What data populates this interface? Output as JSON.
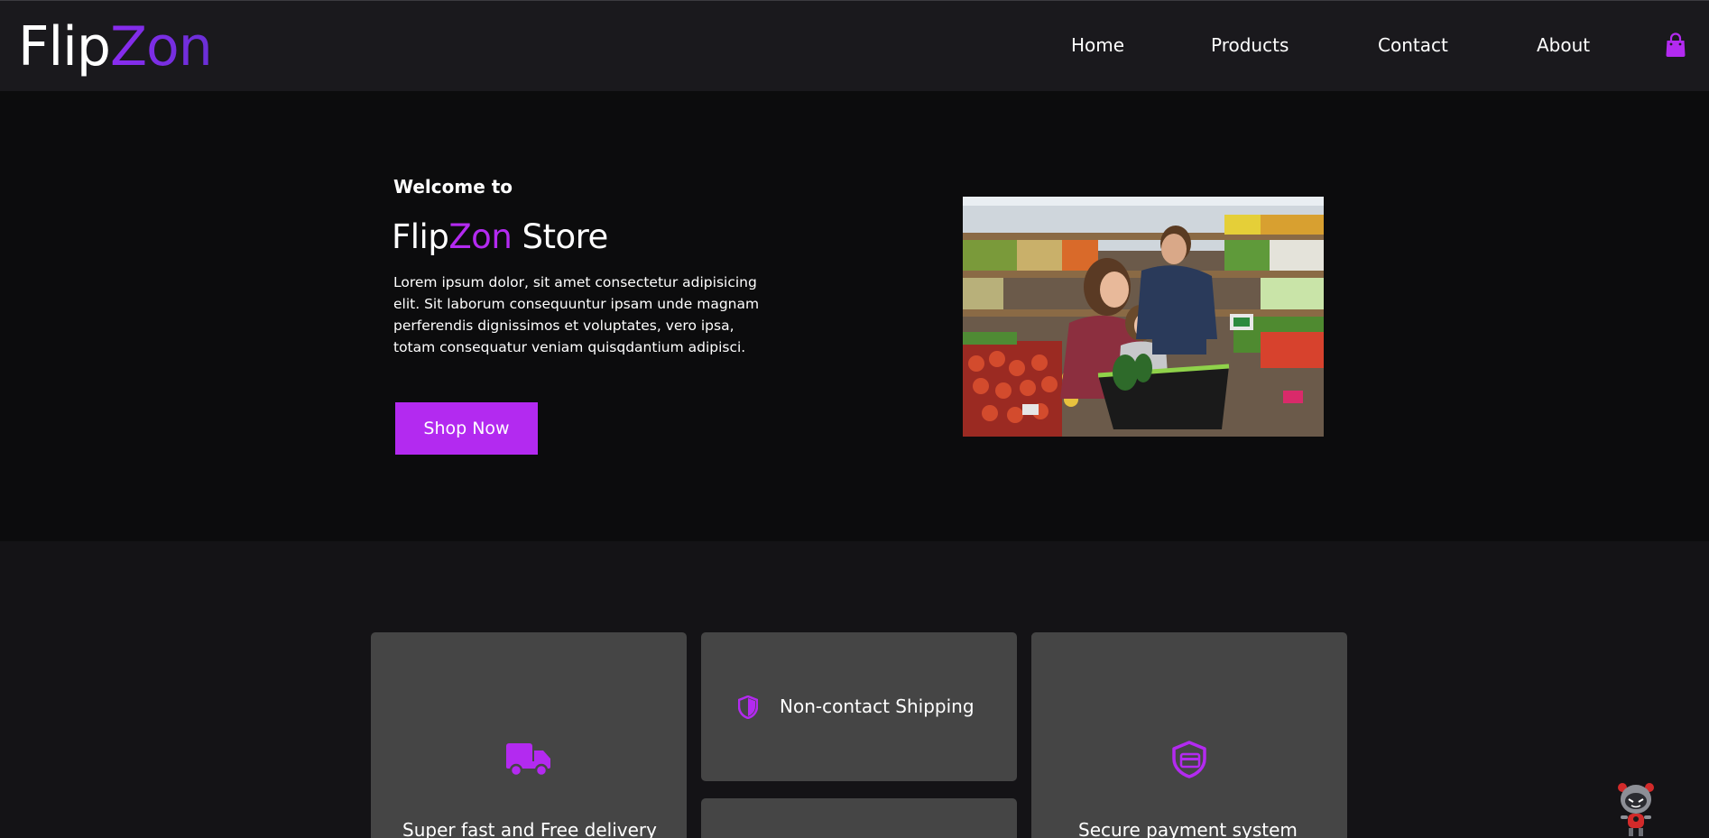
{
  "header": {
    "logo": {
      "part1": "Flip",
      "part2": "Zon"
    },
    "nav": [
      {
        "label": "Home"
      },
      {
        "label": "Products"
      },
      {
        "label": "Contact"
      },
      {
        "label": "About"
      }
    ],
    "cart_icon": "shopping-bag-icon"
  },
  "hero": {
    "welcome": "Welcome to",
    "title": {
      "part1": "Flip",
      "part2": "Zon",
      "part3": " Store"
    },
    "description": "Lorem ipsum dolor, sit amet consectetur adipisicing elit. Sit laborum consequuntur ipsam unde magnam perferendis dignissimos et voluptates, vero ipsa, totam consequatur veniam quisqdantium adipisci.",
    "button": "Shop Now"
  },
  "features": [
    {
      "label": "Super fast and Free delivery",
      "icon": "truck-icon"
    },
    {
      "label": "Non-contact Shipping",
      "icon": "shield-icon"
    },
    {
      "label": "",
      "icon": ""
    },
    {
      "label": "Secure payment system",
      "icon": "secure-card-icon"
    }
  ],
  "colors": {
    "accent": "#b32af0",
    "header_bg": "#1a191d",
    "hero_bg": "#0c0c0d",
    "page_bg": "#141316",
    "card_bg": "#454545"
  }
}
